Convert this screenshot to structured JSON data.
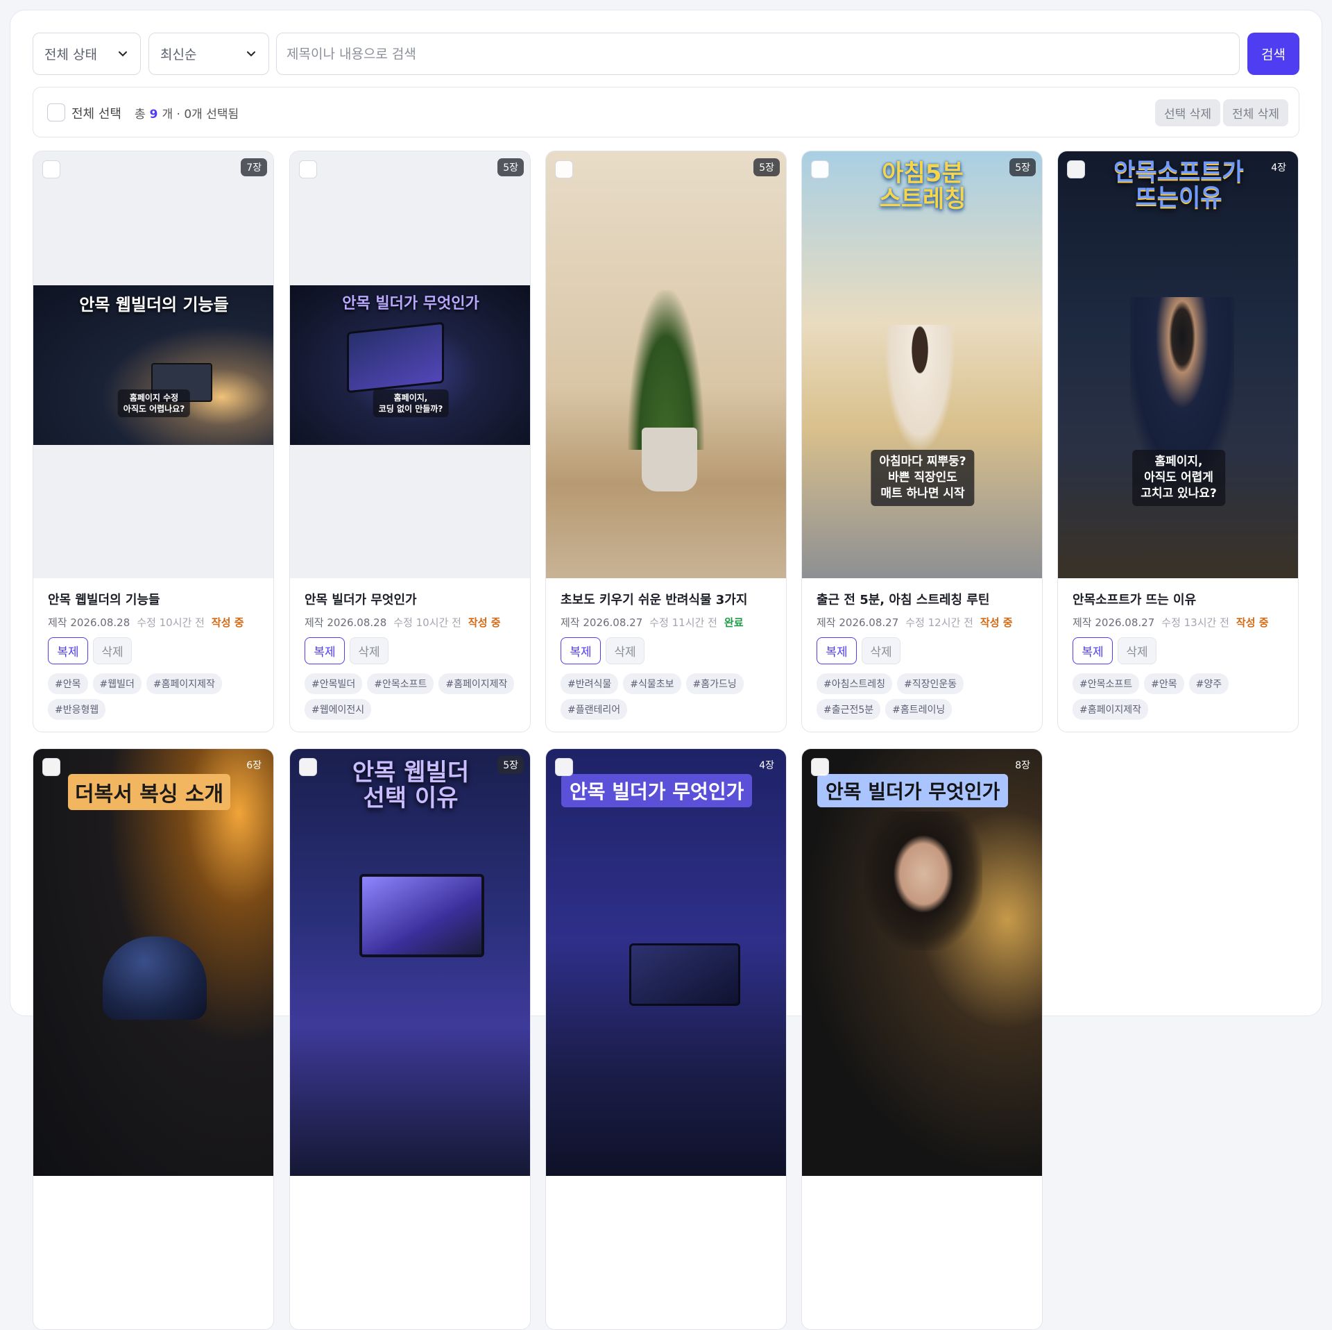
{
  "filters": {
    "status_value": "전체 상태",
    "sort_value": "최신순",
    "search_placeholder": "제목이나 내용으로 검색",
    "search_button": "검색"
  },
  "selection": {
    "select_all_label": "전체 선택",
    "total_prefix": "총",
    "total_count": "9",
    "total_suffix": "개 · 0개 선택됨",
    "delete_selected": "선택 삭제",
    "delete_all": "전체 삭제"
  },
  "accent_color": "#4f3df2",
  "card_labels": {
    "duplicate": "복제",
    "delete": "삭제"
  },
  "cards": [
    {
      "title": "안목 웹빌더의 기능들",
      "pages": "7장",
      "created": "제작 2026.08.28",
      "modified": "수정 10시간 전",
      "status": "작성 중",
      "thumb_title": "안목 웹빌더의 기능들",
      "thumb_caption": "홈페이지 수정\n아직도 어렵나요?",
      "tags": [
        "#안목",
        "#웹빌더",
        "#홈페이지제작",
        "#반응형웹"
      ]
    },
    {
      "title": "안목 빌더가 무엇인가",
      "pages": "5장",
      "created": "제작 2026.08.28",
      "modified": "수정 10시간 전",
      "status": "작성 중",
      "thumb_title": "안목 빌더가 무엇인가",
      "thumb_caption": "홈페이지,\n코딩 없이 만들까?",
      "tags": [
        "#안목빌더",
        "#안목소프트",
        "#홈페이지제작",
        "#웹에이전시"
      ]
    },
    {
      "title": "초보도 키우기 쉬운 반려식물 3가지",
      "pages": "5장",
      "created": "제작 2026.08.27",
      "modified": "수정 11시간 전",
      "status": "완료",
      "tags": [
        "#반려식물",
        "#식물초보",
        "#홈가드닝",
        "#플랜테리어"
      ]
    },
    {
      "title": "출근 전 5분, 아침 스트레칭 루틴",
      "pages": "5장",
      "created": "제작 2026.08.27",
      "modified": "수정 12시간 전",
      "status": "작성 중",
      "thumb_title": "아침5분\n스트레칭",
      "thumb_caption": "아침마다 찌뿌둥?\n바쁜 직장인도\n매트 하나면 시작",
      "tags": [
        "#아침스트레칭",
        "#직장인운동",
        "#출근전5분",
        "#홈트레이닝"
      ]
    },
    {
      "title": "안목소프트가 뜨는 이유",
      "pages": "4장",
      "created": "제작 2026.08.27",
      "modified": "수정 13시간 전",
      "status": "작성 중",
      "thumb_title": "안목소프트가\n뜨는이유",
      "thumb_caption": "홈페이지,\n아직도 어렵게\n고치고 있나요?",
      "tags": [
        "#안목소프트",
        "#안목",
        "#양주",
        "#홈페이지제작"
      ]
    },
    {
      "pages": "6장",
      "thumb_title": "더복서 복싱 소개"
    },
    {
      "pages": "5장",
      "thumb_title": "안목 웹빌더\n선택 이유"
    },
    {
      "pages": "4장",
      "thumb_title": "안목 빌더가 무엇인가"
    },
    {
      "pages": "8장",
      "thumb_title": "안목 빌더가 무엇인가"
    }
  ]
}
